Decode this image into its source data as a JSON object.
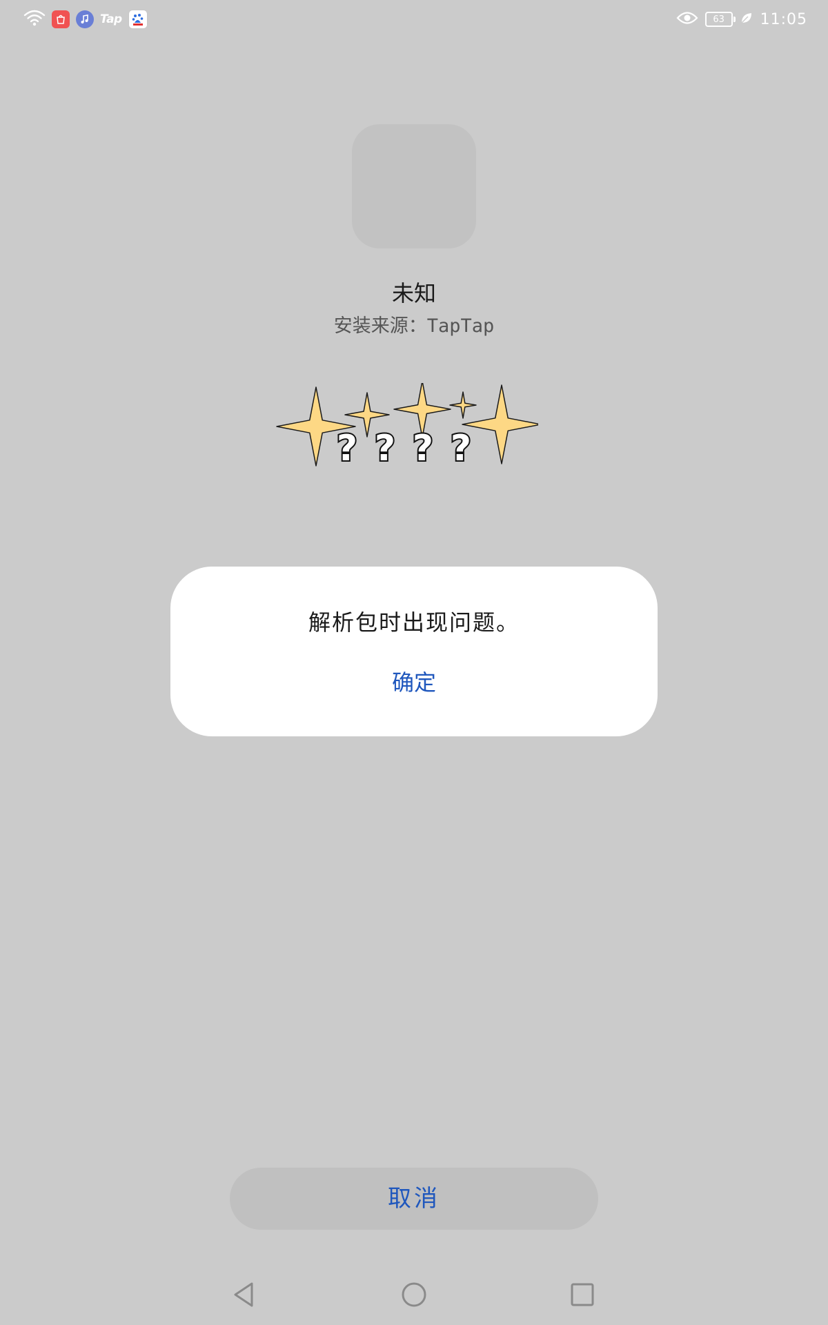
{
  "status_bar": {
    "notification_icons": [
      "wifi-icon",
      "shopping-app-icon",
      "music-app-icon",
      "taptap-app-icon",
      "baidu-app-icon"
    ],
    "tap_logo_text": "Tap",
    "eye_comfort_icon": "eye-icon",
    "battery_level": "63",
    "power_saving_icon": "leaf-icon",
    "time": "11:05"
  },
  "app": {
    "name": "未知",
    "install_source": "安装来源：TapTap"
  },
  "rating": {
    "star_color": "#fdd885",
    "placeholder_text": "？？？？",
    "marks": [
      "?",
      "?",
      "?",
      "?"
    ]
  },
  "dialog": {
    "message": "解析包时出现问题。",
    "ok_label": "确定"
  },
  "cancel_button": {
    "label": "取消"
  },
  "navigation_bar": {
    "back_icon": "back-triangle-icon",
    "home_icon": "home-circle-icon",
    "recent_icon": "recent-square-icon"
  },
  "colors": {
    "background": "#cbcbcb",
    "accent_blue": "#1f57bd",
    "dialog_background": "#ffffff"
  }
}
